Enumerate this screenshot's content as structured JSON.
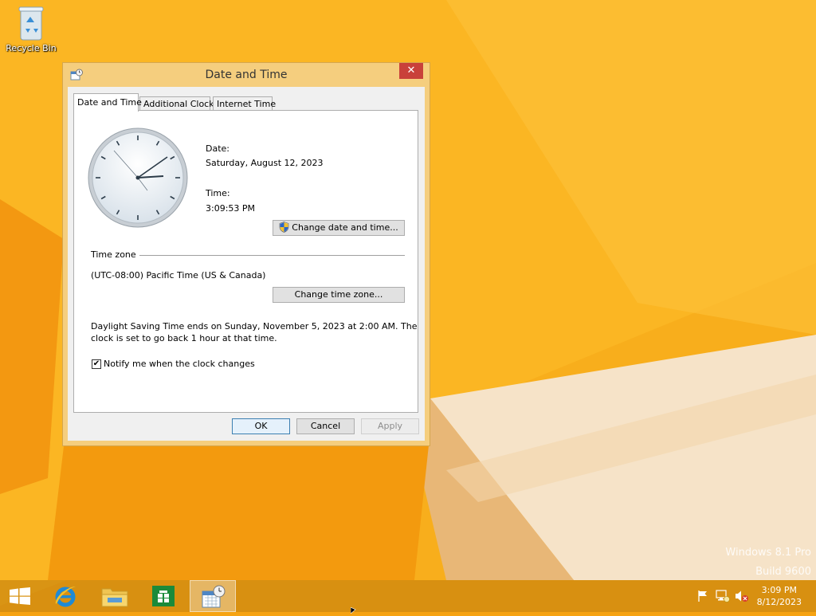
{
  "desktop": {
    "recycle_bin_label": "Recycle Bin",
    "watermark_line1": "Windows 8.1 Pro",
    "watermark_line2": "Build 9600"
  },
  "dialog": {
    "title": "Date and Time",
    "close_glyph": "✕",
    "tabs": [
      "Date and Time",
      "Additional Clocks",
      "Internet Time"
    ],
    "date_label": "Date:",
    "date_value": "Saturday, August 12, 2023",
    "time_label": "Time:",
    "time_value": "3:09:53 PM",
    "change_datetime_button": "Change date and time...",
    "timezone_header": "Time zone",
    "timezone_value": "(UTC-08:00) Pacific Time (US & Canada)",
    "change_timezone_button": "Change time zone...",
    "dst_line1": "Daylight Saving Time ends on Sunday, November 5, 2023 at 2:00 AM. The",
    "dst_line2": "clock is set to go back 1 hour at that time.",
    "notify_label": "Notify me when the clock changes",
    "notify_checked": true,
    "ok_button": "OK",
    "cancel_button": "Cancel",
    "apply_button": "Apply"
  },
  "taskbar": {
    "clock_time": "3:09 PM",
    "clock_date": "8/12/2023"
  },
  "colors": {
    "desktop_orange": "#f6a312",
    "dialog_frame": "#f5ce7e",
    "close_red": "#c9413a"
  }
}
